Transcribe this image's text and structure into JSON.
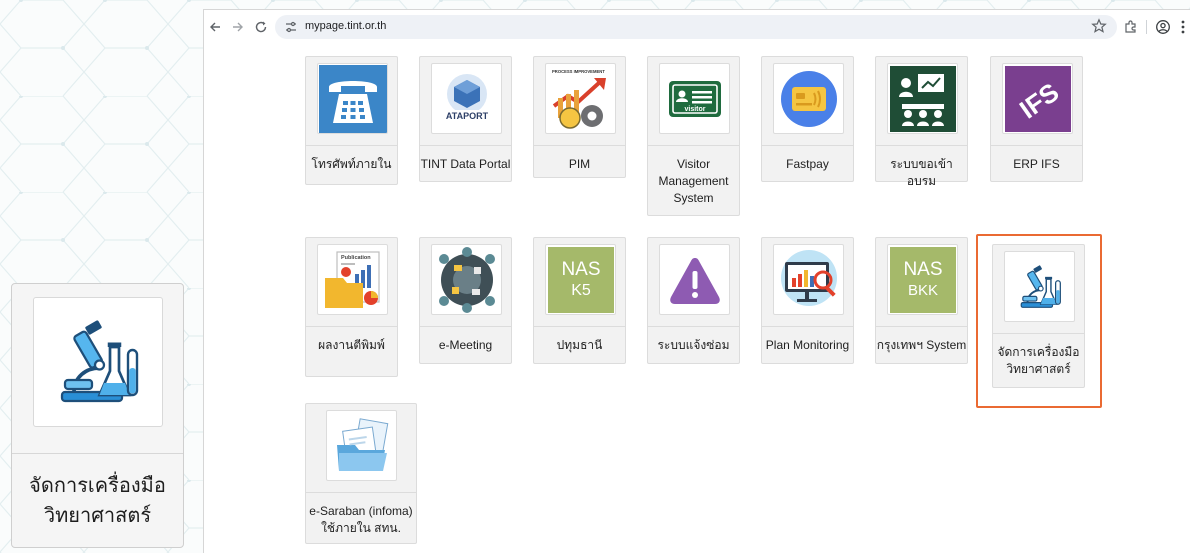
{
  "browser": {
    "url": "mypage.tint.or.th",
    "back_icon": "arrow-left-icon",
    "forward_icon": "arrow-right-icon",
    "reload_icon": "reload-icon",
    "site_info_icon": "tune-icon",
    "bookmark_icon": "star-icon",
    "extensions_icon": "puzzle-icon",
    "profile_icon": "account-circle-icon",
    "menu_icon": "kebab-menu-icon"
  },
  "zoom_callout": {
    "icon": "microscope-flask-icon",
    "label_line1": "จัดการเครื่องมือ",
    "label_line2": "วิทยาศาสตร์"
  },
  "tiles": [
    {
      "id": "phone",
      "icon": "telephone-icon",
      "label": [
        "โทรศัพท์ภายใน"
      ]
    },
    {
      "id": "tint-data-portal",
      "icon": "data-portal-logo-icon",
      "logo_text": "ATAPORT",
      "label": [
        "TINT Data Portal"
      ]
    },
    {
      "id": "pim",
      "icon": "process-improvement-icon",
      "logo_text": "PROCESS IMPROVEMENT",
      "label": [
        "PIM"
      ]
    },
    {
      "id": "visitor",
      "icon": "visitor-badge-icon",
      "logo_text": "visitor",
      "label": [
        "Visitor",
        "Management",
        "System"
      ]
    },
    {
      "id": "fastpay",
      "icon": "contactless-card-icon",
      "label": [
        "Fastpay"
      ]
    },
    {
      "id": "training",
      "icon": "training-meeting-icon",
      "label": [
        "ระบบขอเข้าอบรม"
      ]
    },
    {
      "id": "erp-ifs",
      "icon": "ifs-logo-icon",
      "logo_text": "IFS",
      "label": [
        "ERP IFS"
      ]
    },
    {
      "id": "publications",
      "icon": "publication-folder-icon",
      "logo_text": "Publication",
      "label": [
        "ผลงานตีพิมพ์"
      ]
    },
    {
      "id": "e-meeting",
      "icon": "meeting-table-icon",
      "label": [
        "e-Meeting"
      ]
    },
    {
      "id": "nas-k5",
      "icon": "nas-k5-icon",
      "logo_text": [
        "NAS",
        "K5"
      ],
      "label": [
        "ปทุมธานี"
      ]
    },
    {
      "id": "repair",
      "icon": "warning-triangle-icon",
      "label": [
        "ระบบแจ้งซ่อม"
      ]
    },
    {
      "id": "plan-monitoring",
      "icon": "monitor-chart-icon",
      "label": [
        "Plan Monitoring"
      ]
    },
    {
      "id": "nas-bkk",
      "icon": "nas-bkk-icon",
      "logo_text": [
        "NAS",
        "BKK"
      ],
      "label": [
        "กรุงเทพฯ System"
      ]
    },
    {
      "id": "science-tools",
      "icon": "microscope-flask-icon",
      "label": [
        "จัดการเครื่องมือ",
        "วิทยาศาสตร์"
      ]
    },
    {
      "id": "e-saraban",
      "icon": "documents-icon",
      "label": [
        "e-Saraban (infoma)",
        "ใช้ภายใน สทน."
      ]
    }
  ],
  "highlighted_tile": "science-tools",
  "colors": {
    "highlight": "#ea6a32",
    "phone_blue": "#3b86c8",
    "ifs_purple": "#7a3f8f",
    "nas_green": "#a5b96a",
    "warning_purple": "#8e5bb2"
  }
}
